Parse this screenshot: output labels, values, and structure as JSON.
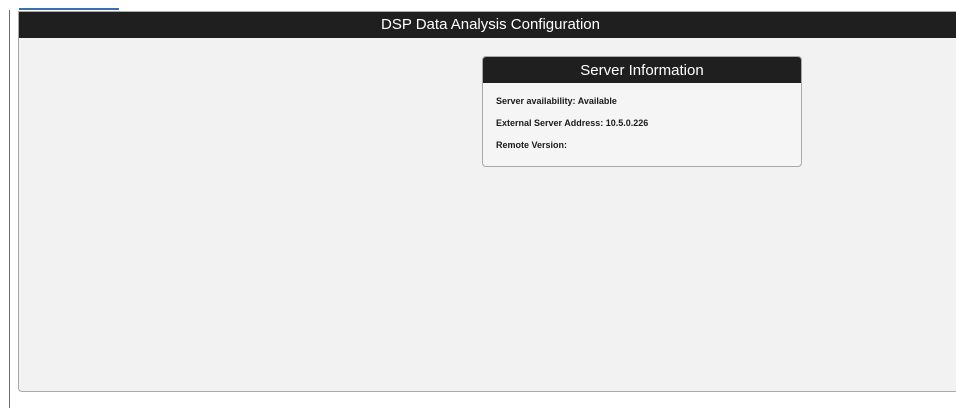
{
  "header": {
    "title": "DSP Data Analysis Configuration"
  },
  "server_info": {
    "title": "Server Information",
    "lines": [
      "Server availability: Available",
      "External Server Address: 10.5.0.226",
      "Remote Version:"
    ]
  }
}
